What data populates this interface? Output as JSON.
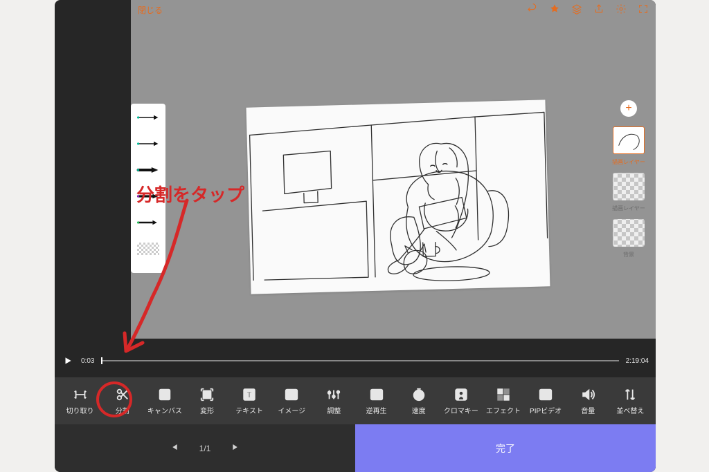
{
  "header": {
    "close": "閉じる",
    "icons": [
      "undo",
      "brush-settings",
      "layers",
      "share",
      "settings",
      "fullscreen"
    ]
  },
  "timeline": {
    "current_time": "0:03",
    "total_time": "2:19:04"
  },
  "layers": {
    "items": [
      {
        "label": "描画レイヤー",
        "selected": true
      },
      {
        "label": "描画レイヤー",
        "selected": false
      },
      {
        "label": "背景",
        "selected": false
      }
    ]
  },
  "tools": [
    {
      "key": "trim",
      "label": "切り取り"
    },
    {
      "key": "split",
      "label": "分割"
    },
    {
      "key": "canvas",
      "label": "キャンバス"
    },
    {
      "key": "transform",
      "label": "変形"
    },
    {
      "key": "text",
      "label": "テキスト"
    },
    {
      "key": "image",
      "label": "イメージ"
    },
    {
      "key": "adjust",
      "label": "調整"
    },
    {
      "key": "reverse",
      "label": "逆再生"
    },
    {
      "key": "speed",
      "label": "速度"
    },
    {
      "key": "chroma",
      "label": "クロマキー"
    },
    {
      "key": "effect",
      "label": "エフェクト"
    },
    {
      "key": "pip",
      "label": "PIPビデオ"
    },
    {
      "key": "volume",
      "label": "音量"
    },
    {
      "key": "reorder",
      "label": "並べ替え"
    }
  ],
  "pager": {
    "prev": "❘◀",
    "page": "1/1",
    "next": "▶❘"
  },
  "done_label": "完了",
  "annotation_text": "分割をタップ"
}
